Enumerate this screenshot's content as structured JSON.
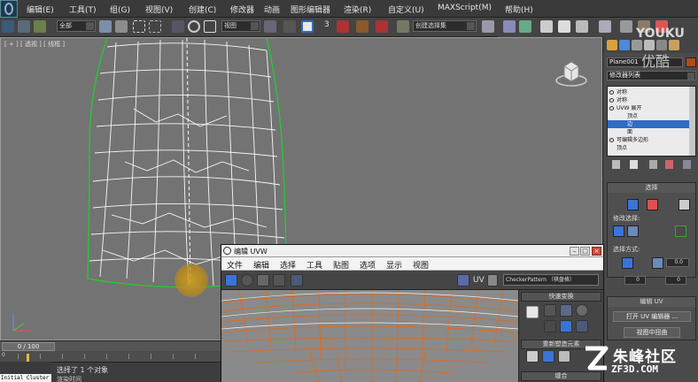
{
  "menu": {
    "items": [
      "编辑(E)",
      "工具(T)",
      "组(G)",
      "视图(V)",
      "创建(C)",
      "修改器",
      "动画",
      "图形编辑器",
      "渲染(R)",
      "自定义(U)",
      "MAXScript(M)",
      "帮助(H)"
    ]
  },
  "toolbar": {
    "selection_filter": "全部",
    "ref_coord": "视图",
    "named_selection": "创建选择集",
    "snap_value": "3"
  },
  "viewport": {
    "label": "[ + ] [ 透视 ] [ 线框 ]"
  },
  "timeline": {
    "frame_readout": "0 / 100",
    "trackbar_label": "0"
  },
  "status": {
    "selection_message": "选择了 1 个对象",
    "prompt_message": "渲染时间",
    "listener_text": "Initial Cluster"
  },
  "command_panel": {
    "object_name": "Plane001",
    "object_color": "#b04c1a",
    "modifier_list_label": "修改器列表",
    "stack": [
      {
        "label": "对称",
        "indent": false,
        "selected": false
      },
      {
        "label": "对称",
        "indent": false,
        "selected": false
      },
      {
        "label": "UVW 展开",
        "indent": false,
        "selected": false
      },
      {
        "label": "顶点",
        "indent": true,
        "selected": false
      },
      {
        "label": "边",
        "indent": true,
        "selected": true
      },
      {
        "label": "面",
        "indent": true,
        "selected": false
      },
      {
        "label": "可编辑多边形",
        "indent": false,
        "selected": false
      },
      {
        "label": "顶点",
        "indent": true,
        "selected": false
      }
    ],
    "selection_rollout": {
      "title": "选择",
      "modifier_selection_label": "修改选择:",
      "select_by_label": "选择方式:",
      "spinner_1": "0.0",
      "spinner_2": "0",
      "spinner_3": "0"
    },
    "edit_uv_rollout": {
      "title": "编辑 UV",
      "open_editor_button": "打开 UV 编辑器 ...",
      "tweak_button": "视图中扭曲"
    }
  },
  "uvw_editor": {
    "title": "编辑 UVW",
    "menu": [
      "文件",
      "编辑",
      "选择",
      "工具",
      "贴图",
      "选项",
      "显示",
      "视图"
    ],
    "uv_label": "UV",
    "checker_pattern": "CheckerPattern （棋盘格）",
    "side_rollouts": [
      "快速变换",
      "重新塑造元素",
      "缝合"
    ]
  },
  "watermarks": {
    "youku_top": "YOUKU",
    "youku_bottom": "优酷",
    "site_name": "朱峰社区",
    "site_url": "ZF3D.COM"
  },
  "colors": {
    "viewport_bg": "#737373",
    "mesh_wire": "#ffffff",
    "mesh_border": "#22cc33",
    "uv_wire": "#e06a1c",
    "accent_blue": "#2f6cc4"
  }
}
